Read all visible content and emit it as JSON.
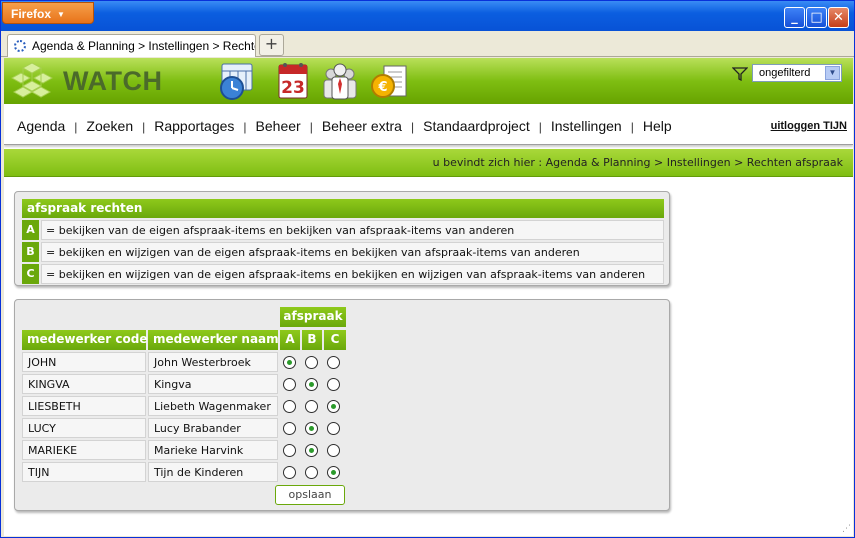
{
  "browser": {
    "app_button": "Firefox",
    "tab_title": "Agenda & Planning > Instellingen > Rechten...",
    "new_tab_label": "+"
  },
  "header": {
    "logo_text": "WATCH",
    "filter_value": "ongefilterd"
  },
  "menu": {
    "items": [
      "Agenda",
      "Zoeken",
      "Rapportages",
      "Beheer",
      "Beheer extra",
      "Standaardproject",
      "Instellingen",
      "Help"
    ],
    "logout": "uitloggen TIJN"
  },
  "breadcrumb": "u bevindt zich hier : Agenda & Planning > Instellingen > Rechten afspraak",
  "legend": {
    "title": "afspraak rechten",
    "rows": [
      {
        "key": "A",
        "text": "= bekijken van de eigen afspraak-items en bekijken van afspraak-items van anderen"
      },
      {
        "key": "B",
        "text": "= bekijken en wijzigen van de eigen afspraak-items en bekijken van afspraak-items van anderen"
      },
      {
        "key": "C",
        "text": "= bekijken en wijzigen van de eigen afspraak-items en bekijken en wijzigen van afspraak-items van anderen"
      }
    ]
  },
  "table": {
    "group_header": "afspraak",
    "col_code": "medewerker code",
    "col_name": "medewerker naam",
    "col_a": "A",
    "col_b": "B",
    "col_c": "C",
    "rows": [
      {
        "code": "JOHN",
        "name": "John Westerbroek",
        "selected": "A"
      },
      {
        "code": "KINGVA",
        "name": "Kingva",
        "selected": "B"
      },
      {
        "code": "LIESBETH",
        "name": "Liebeth Wagenmaker",
        "selected": "C"
      },
      {
        "code": "LUCY",
        "name": "Lucy Brabander",
        "selected": "B"
      },
      {
        "code": "MARIEKE",
        "name": "Marieke Harvink",
        "selected": "B"
      },
      {
        "code": "TIJN",
        "name": "Tijn de Kinderen",
        "selected": "C"
      }
    ],
    "save_label": "opslaan"
  },
  "colors": {
    "accent_green": "#7fbe12",
    "dark_green": "#6aa80b"
  }
}
